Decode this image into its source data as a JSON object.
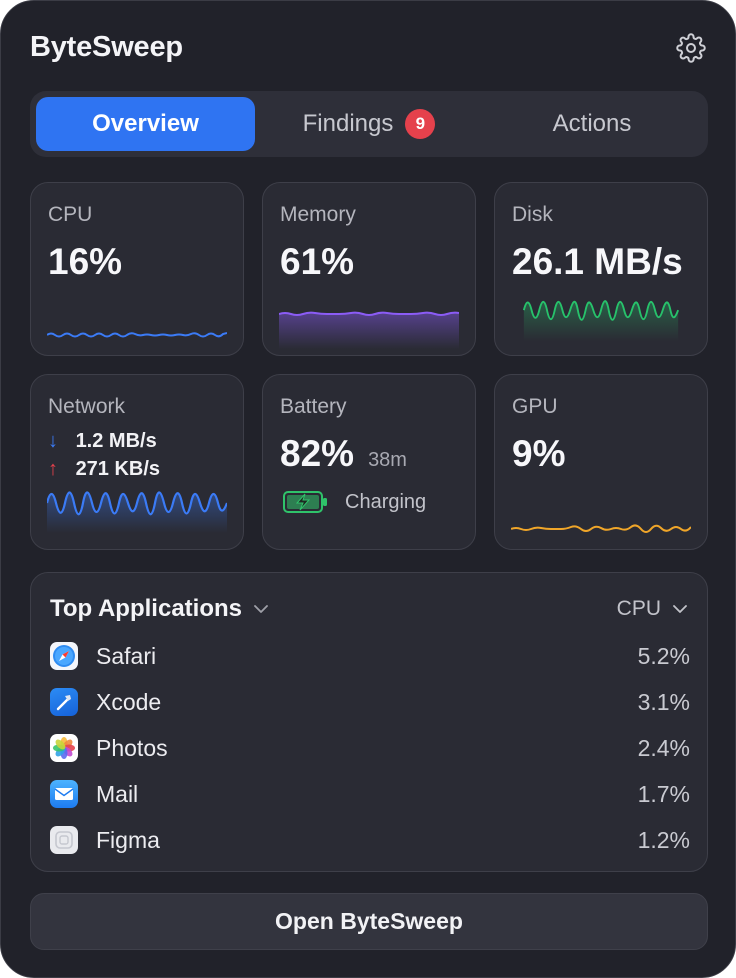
{
  "app": {
    "title": "ByteSweep"
  },
  "tabs": {
    "overview": "Overview",
    "findings": "Findings",
    "findings_count": "9",
    "actions": "Actions"
  },
  "metrics": {
    "cpu": {
      "label": "CPU",
      "value": "16%",
      "color": "#3b7bf6"
    },
    "memory": {
      "label": "Memory",
      "value": "61%",
      "color": "#8b5cf6"
    },
    "disk": {
      "label": "Disk",
      "value": "26.1 MB/s",
      "color": "#27c26b"
    },
    "network": {
      "label": "Network",
      "down_arrow": "↓",
      "down": "1.2 MB/s",
      "up_arrow": "↑",
      "up": "271 KB/s",
      "color": "#3b7bf6"
    },
    "battery": {
      "label": "Battery",
      "value": "82%",
      "time": "38m",
      "status": "Charging",
      "color": "#2fc36a"
    },
    "gpu": {
      "label": "GPU",
      "value": "9%",
      "color": "#f0a629"
    }
  },
  "top_apps": {
    "title": "Top Applications",
    "sort_by": "CPU",
    "items": [
      {
        "name": "Safari",
        "value": "5.2%",
        "icon": "safari-icon"
      },
      {
        "name": "Xcode",
        "value": "3.1%",
        "icon": "xcode-icon"
      },
      {
        "name": "Photos",
        "value": "2.4%",
        "icon": "photos-icon"
      },
      {
        "name": "Mail",
        "value": "1.7%",
        "icon": "mail-icon"
      },
      {
        "name": "Figma",
        "value": "1.2%",
        "icon": "figma-icon"
      }
    ]
  },
  "footer": {
    "open_label": "Open ByteSweep"
  }
}
